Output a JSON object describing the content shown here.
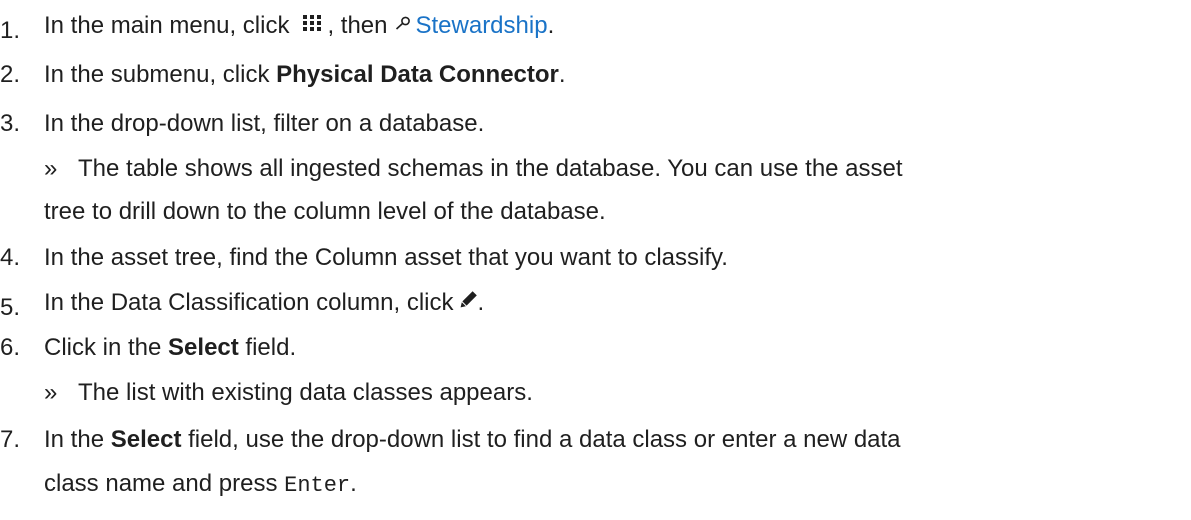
{
  "steps": [
    {
      "number": "1.",
      "before": "In the main menu, click",
      "middle": ", then",
      "link": "Stewardship",
      "after": "."
    },
    {
      "number": "2.",
      "before": "In the submenu, click ",
      "bold": "Physical Data Connector",
      "after": "."
    },
    {
      "number": "3.",
      "text": "In the drop-down list, filter on a database.",
      "result_marker": "»",
      "result_line1": "The table shows all ingested schemas in the database. You can use the asset",
      "result_line2": "tree to drill down to the column level of the database."
    },
    {
      "number": "4.",
      "text": "In the asset tree, find the Column asset that you want to classify."
    },
    {
      "number": "5.",
      "before": "In the Data Classification column, click",
      "after": "."
    },
    {
      "number": "6.",
      "before": "Click in the ",
      "bold": "Select",
      "after": " field.",
      "result_marker": "»",
      "result": "The list with existing data classes appears."
    },
    {
      "number": "7.",
      "before": "In the ",
      "bold": "Select",
      "after": " field, use the drop-down list to find a data class or enter a new data",
      "line2_before": "class name and press ",
      "key": "Enter",
      "line2_after": "."
    }
  ],
  "icons": {
    "menu": "apps-grid-icon",
    "stewardship": "stewardship-icon",
    "edit": "pencil-icon"
  },
  "colors": {
    "text": "#1f1f1f",
    "link": "#1a73c7"
  }
}
